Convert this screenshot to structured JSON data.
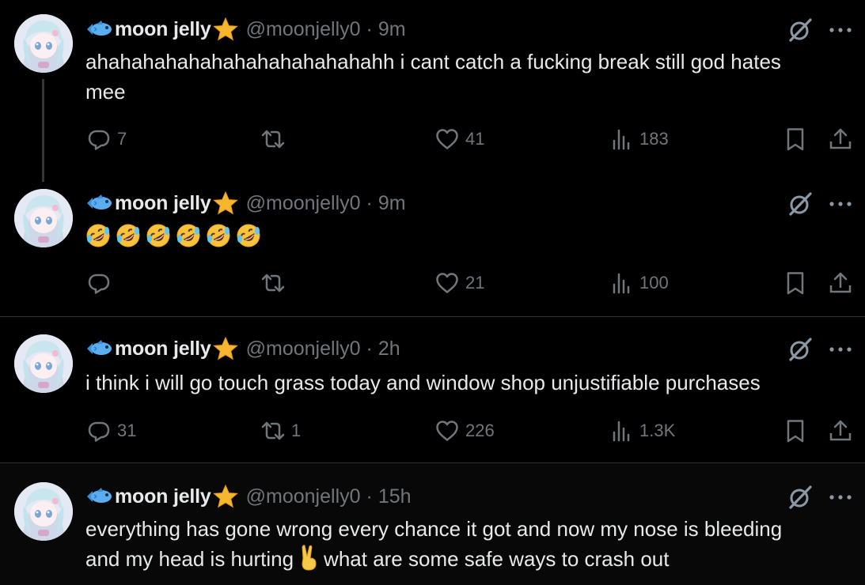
{
  "author": {
    "display_name": "moon jelly",
    "handle": "@moonjelly0",
    "fish_icon": "fish-emoji-icon",
    "star_icon": "star-emoji-icon"
  },
  "separator": "·",
  "tweets": [
    {
      "time": "9m",
      "text": "ahahahahahahahahahahahahahh i cant catch a fucking break still god hates mee",
      "replies": "7",
      "reposts": "",
      "likes": "41",
      "views": "183"
    },
    {
      "time": "9m",
      "emoji": "🤣🤣🤣🤣🤣🤣",
      "replies": "",
      "reposts": "",
      "likes": "21",
      "views": "100"
    },
    {
      "time": "2h",
      "text": "i think i will go touch grass today and window shop unjustifiable purchases",
      "replies": "31",
      "reposts": "1",
      "likes": "226",
      "views": "1.3K"
    },
    {
      "time": "15h",
      "text_line1": "everything has gone wrong every chance it got and now my nose is bleeding",
      "text_line2a": "and my head is hurting",
      "text_line2b": "what are some safe ways to crash out",
      "inline_emoji": "victory-hand-emoji"
    }
  ],
  "colors": {
    "background": "#000000",
    "text": "#e7e9ea",
    "muted": "#71767b",
    "divider": "#2f3336"
  }
}
